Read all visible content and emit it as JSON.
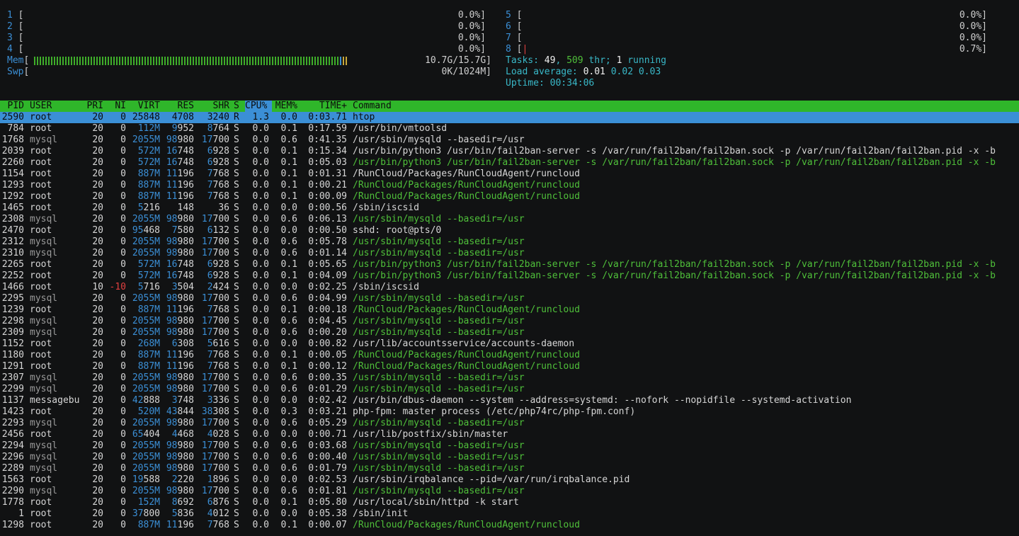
{
  "cpus_left": [
    {
      "id": "1",
      "pct": "0.0%"
    },
    {
      "id": "2",
      "pct": "0.0%"
    },
    {
      "id": "3",
      "pct": "0.0%"
    },
    {
      "id": "4",
      "pct": "0.0%"
    }
  ],
  "cpus_right": [
    {
      "id": "5",
      "pct": "0.0%"
    },
    {
      "id": "6",
      "pct": "0.0%"
    },
    {
      "id": "7",
      "pct": "0.0%"
    },
    {
      "id": "8",
      "pct": "0.7%"
    }
  ],
  "mem": {
    "label": "Mem",
    "value": "10.7G/15.7G"
  },
  "swp": {
    "label": "Swp",
    "value": "0K/1024M"
  },
  "tasks": {
    "label": "Tasks:",
    "tasks": "49",
    "thr": "509",
    "thr_label": "thr;",
    "running": "1",
    "running_label": "running"
  },
  "load": {
    "label": "Load average:",
    "one": "0.01",
    "five": "0.02",
    "fifteen": "0.03"
  },
  "uptime": {
    "label": "Uptime:",
    "value": "00:34:06"
  },
  "header": {
    "pid": "PID",
    "user": "USER",
    "pri": "PRI",
    "ni": "NI",
    "virt": "VIRT",
    "res": "RES",
    "shr": "SHR",
    "s": "S",
    "cpu": "CPU%",
    "mem": "MEM%",
    "time": "TIME+",
    "cmd": "Command"
  },
  "colors": {
    "meter_blue": "#3b8fd6",
    "header_green": "#2fb62a",
    "selection_blue": "#3b8fd6",
    "thread_green": "#4fc03a",
    "negative_red": "#e04040"
  },
  "processes": [
    {
      "pid": "2590",
      "user": "root",
      "pri": "20",
      "ni": "0",
      "virt": "25848",
      "res": "4708",
      "shr": "3240",
      "s": "R",
      "cpu": "1.3",
      "mem": "0.0",
      "time": "0:03.71",
      "cmd": "htop",
      "thread": false,
      "selected": true
    },
    {
      "pid": "784",
      "user": "root",
      "pri": "20",
      "ni": "0",
      "virt": "112M",
      "res": "9952",
      "shr": "8764",
      "s": "S",
      "cpu": "0.0",
      "mem": "0.1",
      "time": "0:17.59",
      "cmd": "/usr/bin/vmtoolsd",
      "thread": false
    },
    {
      "pid": "1768",
      "user": "mysql",
      "pri": "20",
      "ni": "0",
      "virt": "2055M",
      "res": "98980",
      "shr": "17700",
      "s": "S",
      "cpu": "0.0",
      "mem": "0.6",
      "time": "0:41.35",
      "cmd": "/usr/sbin/mysqld --basedir=/usr",
      "thread": false
    },
    {
      "pid": "2039",
      "user": "root",
      "pri": "20",
      "ni": "0",
      "virt": "572M",
      "res": "16748",
      "shr": "6928",
      "s": "S",
      "cpu": "0.0",
      "mem": "0.1",
      "time": "0:15.34",
      "cmd": "/usr/bin/python3 /usr/bin/fail2ban-server -s /var/run/fail2ban/fail2ban.sock -p /var/run/fail2ban/fail2ban.pid -x -b",
      "thread": false
    },
    {
      "pid": "2260",
      "user": "root",
      "pri": "20",
      "ni": "0",
      "virt": "572M",
      "res": "16748",
      "shr": "6928",
      "s": "S",
      "cpu": "0.0",
      "mem": "0.1",
      "time": "0:05.03",
      "cmd": "/usr/bin/python3 /usr/bin/fail2ban-server -s /var/run/fail2ban/fail2ban.sock -p /var/run/fail2ban/fail2ban.pid -x -b",
      "thread": true
    },
    {
      "pid": "1154",
      "user": "root",
      "pri": "20",
      "ni": "0",
      "virt": "887M",
      "res": "11196",
      "shr": "7768",
      "s": "S",
      "cpu": "0.0",
      "mem": "0.1",
      "time": "0:01.31",
      "cmd": "/RunCloud/Packages/RunCloudAgent/runcloud",
      "thread": false
    },
    {
      "pid": "1293",
      "user": "root",
      "pri": "20",
      "ni": "0",
      "virt": "887M",
      "res": "11196",
      "shr": "7768",
      "s": "S",
      "cpu": "0.0",
      "mem": "0.1",
      "time": "0:00.21",
      "cmd": "/RunCloud/Packages/RunCloudAgent/runcloud",
      "thread": true
    },
    {
      "pid": "1292",
      "user": "root",
      "pri": "20",
      "ni": "0",
      "virt": "887M",
      "res": "11196",
      "shr": "7768",
      "s": "S",
      "cpu": "0.0",
      "mem": "0.1",
      "time": "0:00.09",
      "cmd": "/RunCloud/Packages/RunCloudAgent/runcloud",
      "thread": true
    },
    {
      "pid": "1465",
      "user": "root",
      "pri": "20",
      "ni": "0",
      "virt": "5216",
      "res": "148",
      "shr": "36",
      "s": "S",
      "cpu": "0.0",
      "mem": "0.0",
      "time": "0:00.56",
      "cmd": "/sbin/iscsid",
      "thread": false
    },
    {
      "pid": "2308",
      "user": "mysql",
      "pri": "20",
      "ni": "0",
      "virt": "2055M",
      "res": "98980",
      "shr": "17700",
      "s": "S",
      "cpu": "0.0",
      "mem": "0.6",
      "time": "0:06.13",
      "cmd": "/usr/sbin/mysqld --basedir=/usr",
      "thread": true
    },
    {
      "pid": "2470",
      "user": "root",
      "pri": "20",
      "ni": "0",
      "virt": "95468",
      "res": "7580",
      "shr": "6132",
      "s": "S",
      "cpu": "0.0",
      "mem": "0.0",
      "time": "0:00.50",
      "cmd": "sshd: root@pts/0",
      "thread": false
    },
    {
      "pid": "2312",
      "user": "mysql",
      "pri": "20",
      "ni": "0",
      "virt": "2055M",
      "res": "98980",
      "shr": "17700",
      "s": "S",
      "cpu": "0.0",
      "mem": "0.6",
      "time": "0:05.78",
      "cmd": "/usr/sbin/mysqld --basedir=/usr",
      "thread": true
    },
    {
      "pid": "2310",
      "user": "mysql",
      "pri": "20",
      "ni": "0",
      "virt": "2055M",
      "res": "98980",
      "shr": "17700",
      "s": "S",
      "cpu": "0.0",
      "mem": "0.6",
      "time": "0:01.14",
      "cmd": "/usr/sbin/mysqld --basedir=/usr",
      "thread": true
    },
    {
      "pid": "2265",
      "user": "root",
      "pri": "20",
      "ni": "0",
      "virt": "572M",
      "res": "16748",
      "shr": "6928",
      "s": "S",
      "cpu": "0.0",
      "mem": "0.1",
      "time": "0:05.65",
      "cmd": "/usr/bin/python3 /usr/bin/fail2ban-server -s /var/run/fail2ban/fail2ban.sock -p /var/run/fail2ban/fail2ban.pid -x -b",
      "thread": true
    },
    {
      "pid": "2252",
      "user": "root",
      "pri": "20",
      "ni": "0",
      "virt": "572M",
      "res": "16748",
      "shr": "6928",
      "s": "S",
      "cpu": "0.0",
      "mem": "0.1",
      "time": "0:04.09",
      "cmd": "/usr/bin/python3 /usr/bin/fail2ban-server -s /var/run/fail2ban/fail2ban.sock -p /var/run/fail2ban/fail2ban.pid -x -b",
      "thread": true
    },
    {
      "pid": "1466",
      "user": "root",
      "pri": "10",
      "ni": "-10",
      "virt": "5716",
      "res": "3504",
      "shr": "2424",
      "s": "S",
      "cpu": "0.0",
      "mem": "0.0",
      "time": "0:02.25",
      "cmd": "/sbin/iscsid",
      "thread": false,
      "negative_ni": true
    },
    {
      "pid": "2295",
      "user": "mysql",
      "pri": "20",
      "ni": "0",
      "virt": "2055M",
      "res": "98980",
      "shr": "17700",
      "s": "S",
      "cpu": "0.0",
      "mem": "0.6",
      "time": "0:04.99",
      "cmd": "/usr/sbin/mysqld --basedir=/usr",
      "thread": true
    },
    {
      "pid": "1239",
      "user": "root",
      "pri": "20",
      "ni": "0",
      "virt": "887M",
      "res": "11196",
      "shr": "7768",
      "s": "S",
      "cpu": "0.0",
      "mem": "0.1",
      "time": "0:00.18",
      "cmd": "/RunCloud/Packages/RunCloudAgent/runcloud",
      "thread": true
    },
    {
      "pid": "2298",
      "user": "mysql",
      "pri": "20",
      "ni": "0",
      "virt": "2055M",
      "res": "98980",
      "shr": "17700",
      "s": "S",
      "cpu": "0.0",
      "mem": "0.6",
      "time": "0:04.45",
      "cmd": "/usr/sbin/mysqld --basedir=/usr",
      "thread": true
    },
    {
      "pid": "2309",
      "user": "mysql",
      "pri": "20",
      "ni": "0",
      "virt": "2055M",
      "res": "98980",
      "shr": "17700",
      "s": "S",
      "cpu": "0.0",
      "mem": "0.6",
      "time": "0:00.20",
      "cmd": "/usr/sbin/mysqld --basedir=/usr",
      "thread": true
    },
    {
      "pid": "1152",
      "user": "root",
      "pri": "20",
      "ni": "0",
      "virt": "268M",
      "res": "6308",
      "shr": "5616",
      "s": "S",
      "cpu": "0.0",
      "mem": "0.0",
      "time": "0:00.82",
      "cmd": "/usr/lib/accountsservice/accounts-daemon",
      "thread": false
    },
    {
      "pid": "1180",
      "user": "root",
      "pri": "20",
      "ni": "0",
      "virt": "887M",
      "res": "11196",
      "shr": "7768",
      "s": "S",
      "cpu": "0.0",
      "mem": "0.1",
      "time": "0:00.05",
      "cmd": "/RunCloud/Packages/RunCloudAgent/runcloud",
      "thread": true
    },
    {
      "pid": "1291",
      "user": "root",
      "pri": "20",
      "ni": "0",
      "virt": "887M",
      "res": "11196",
      "shr": "7768",
      "s": "S",
      "cpu": "0.0",
      "mem": "0.1",
      "time": "0:00.12",
      "cmd": "/RunCloud/Packages/RunCloudAgent/runcloud",
      "thread": true
    },
    {
      "pid": "2307",
      "user": "mysql",
      "pri": "20",
      "ni": "0",
      "virt": "2055M",
      "res": "98980",
      "shr": "17700",
      "s": "S",
      "cpu": "0.0",
      "mem": "0.6",
      "time": "0:00.35",
      "cmd": "/usr/sbin/mysqld --basedir=/usr",
      "thread": true
    },
    {
      "pid": "2299",
      "user": "mysql",
      "pri": "20",
      "ni": "0",
      "virt": "2055M",
      "res": "98980",
      "shr": "17700",
      "s": "S",
      "cpu": "0.0",
      "mem": "0.6",
      "time": "0:01.29",
      "cmd": "/usr/sbin/mysqld --basedir=/usr",
      "thread": true
    },
    {
      "pid": "1137",
      "user": "messagebu",
      "pri": "20",
      "ni": "0",
      "virt": "42888",
      "res": "3748",
      "shr": "3336",
      "s": "S",
      "cpu": "0.0",
      "mem": "0.0",
      "time": "0:02.42",
      "cmd": "/usr/bin/dbus-daemon --system --address=systemd: --nofork --nopidfile --systemd-activation",
      "thread": false
    },
    {
      "pid": "1423",
      "user": "root",
      "pri": "20",
      "ni": "0",
      "virt": "520M",
      "res": "43844",
      "shr": "38308",
      "s": "S",
      "cpu": "0.0",
      "mem": "0.3",
      "time": "0:03.21",
      "cmd": "php-fpm: master process (/etc/php74rc/php-fpm.conf)",
      "thread": false
    },
    {
      "pid": "2293",
      "user": "mysql",
      "pri": "20",
      "ni": "0",
      "virt": "2055M",
      "res": "98980",
      "shr": "17700",
      "s": "S",
      "cpu": "0.0",
      "mem": "0.6",
      "time": "0:05.29",
      "cmd": "/usr/sbin/mysqld --basedir=/usr",
      "thread": true
    },
    {
      "pid": "2456",
      "user": "root",
      "pri": "20",
      "ni": "0",
      "virt": "65404",
      "res": "4468",
      "shr": "4028",
      "s": "S",
      "cpu": "0.0",
      "mem": "0.0",
      "time": "0:00.71",
      "cmd": "/usr/lib/postfix/sbin/master",
      "thread": false
    },
    {
      "pid": "2294",
      "user": "mysql",
      "pri": "20",
      "ni": "0",
      "virt": "2055M",
      "res": "98980",
      "shr": "17700",
      "s": "S",
      "cpu": "0.0",
      "mem": "0.6",
      "time": "0:03.68",
      "cmd": "/usr/sbin/mysqld --basedir=/usr",
      "thread": true
    },
    {
      "pid": "2296",
      "user": "mysql",
      "pri": "20",
      "ni": "0",
      "virt": "2055M",
      "res": "98980",
      "shr": "17700",
      "s": "S",
      "cpu": "0.0",
      "mem": "0.6",
      "time": "0:00.40",
      "cmd": "/usr/sbin/mysqld --basedir=/usr",
      "thread": true
    },
    {
      "pid": "2289",
      "user": "mysql",
      "pri": "20",
      "ni": "0",
      "virt": "2055M",
      "res": "98980",
      "shr": "17700",
      "s": "S",
      "cpu": "0.0",
      "mem": "0.6",
      "time": "0:01.79",
      "cmd": "/usr/sbin/mysqld --basedir=/usr",
      "thread": true
    },
    {
      "pid": "1563",
      "user": "root",
      "pri": "20",
      "ni": "0",
      "virt": "19588",
      "res": "2220",
      "shr": "1896",
      "s": "S",
      "cpu": "0.0",
      "mem": "0.0",
      "time": "0:02.53",
      "cmd": "/usr/sbin/irqbalance --pid=/var/run/irqbalance.pid",
      "thread": false
    },
    {
      "pid": "2290",
      "user": "mysql",
      "pri": "20",
      "ni": "0",
      "virt": "2055M",
      "res": "98980",
      "shr": "17700",
      "s": "S",
      "cpu": "0.0",
      "mem": "0.6",
      "time": "0:01.81",
      "cmd": "/usr/sbin/mysqld --basedir=/usr",
      "thread": true
    },
    {
      "pid": "1778",
      "user": "root",
      "pri": "20",
      "ni": "0",
      "virt": "152M",
      "res": "8692",
      "shr": "6876",
      "s": "S",
      "cpu": "0.0",
      "mem": "0.1",
      "time": "0:05.80",
      "cmd": "/usr/local/sbin/httpd -k start",
      "thread": false
    },
    {
      "pid": "1",
      "user": "root",
      "pri": "20",
      "ni": "0",
      "virt": "37800",
      "res": "5836",
      "shr": "4012",
      "s": "S",
      "cpu": "0.0",
      "mem": "0.0",
      "time": "0:05.38",
      "cmd": "/sbin/init",
      "thread": false
    },
    {
      "pid": "1298",
      "user": "root",
      "pri": "20",
      "ni": "0",
      "virt": "887M",
      "res": "11196",
      "shr": "7768",
      "s": "S",
      "cpu": "0.0",
      "mem": "0.1",
      "time": "0:00.07",
      "cmd": "/RunCloud/Packages/RunCloudAgent/runcloud",
      "thread": true
    }
  ]
}
